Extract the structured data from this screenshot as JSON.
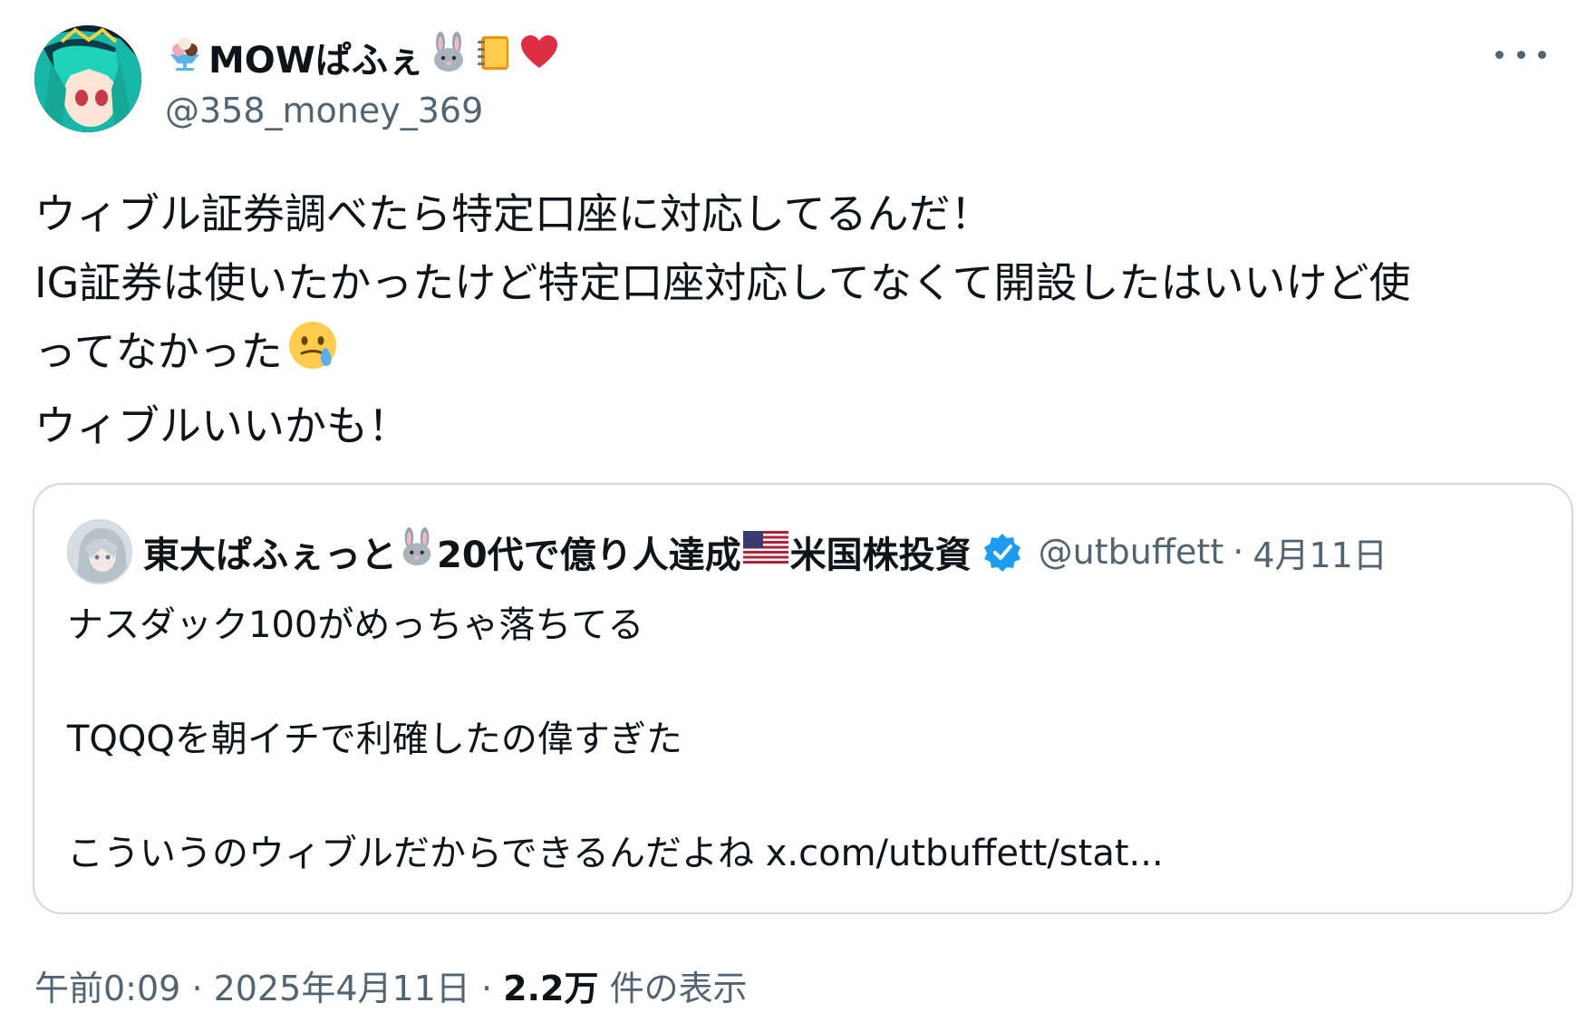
{
  "author": {
    "display_name": "MOWぱふぇ",
    "name_emoji_prefix": "🍨",
    "name_emoji_suffix": [
      "🐰",
      "📒",
      "❤"
    ],
    "handle": "@358_money_369"
  },
  "tweet": {
    "lines": [
      "ウィブル証券調べたら特定口座に対応してるんだ！",
      "IG証券は使いたかったけど特定口座対応してなくて開設したはいいけど使",
      "ってなかった",
      "ウィブルいいかも！"
    ],
    "line3_emoji": "face-holding-back-tears"
  },
  "quote": {
    "display_name_part1": "東大ぱふぇっと",
    "display_name_part2": "20代で億り人達成",
    "display_name_part3": "米国株投資",
    "handle": "@utbuffett",
    "separator": "·",
    "date": "4月11日",
    "lines": [
      "ナスダック100がめっちゃ落ちてる",
      "",
      "TQQQを朝イチで利確したの偉すぎた",
      "",
      "こういうのウィブルだからできるんだよね"
    ],
    "link": "x.com/utbuffett/stat..."
  },
  "footer": {
    "time": "午前0:09",
    "sep1": "·",
    "date": "2025年4月11日",
    "sep2": "·",
    "views_count": "2.2万",
    "views_label": "件の表示"
  },
  "colors": {
    "text_primary": "#0f1419",
    "text_secondary": "#536471",
    "border": "#cfd9de",
    "verified_blue": "#1d9bf0"
  }
}
